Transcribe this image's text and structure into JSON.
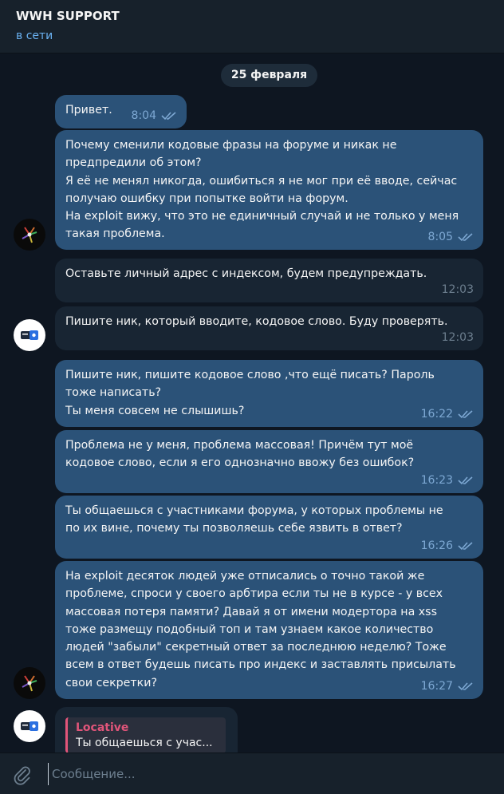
{
  "header": {
    "title": "WWH SUPPORT",
    "status": "в сети"
  },
  "date_separator": "25 февраля",
  "messages": [
    {
      "text": "Привет.",
      "time": "8:04"
    },
    {
      "text": "Почему сменили кодовые фразы на форуме и никак не\nпредпредили об этом?\nЯ её не менял никогда, ошибиться я не мог при её вводе, сейчас\nполучаю ошибку при попытке войти на форум.\nНа exploit вижу, что это не единичный случай и не только у меня\nтакая проблема.",
      "time": "8:05"
    },
    {
      "text": "Оставьте личный адрес с индексом, будем предупреждать.",
      "time": "12:03"
    },
    {
      "text": "Пишите ник, который вводите, кодовое слово. Буду проверять.",
      "time": "12:03"
    },
    {
      "text": "Пишите ник, пишите кодовое слово ,что ещё писать? Пароль\nтоже написать?\nТы меня совсем не слышишь?",
      "time": "16:22"
    },
    {
      "text": "Проблема не у меня, проблема массовая! Причём тут моё\nкодовое слово, если я его однозначно ввожу без ошибок?",
      "time": "16:23"
    },
    {
      "text": "Ты общаешься с участниками форума, у которых проблемы не\nпо их вине, почему ты позволяешь себе язвить в ответ?",
      "time": "16:26"
    },
    {
      "text": "На exploit десяток людей уже отписались о точно такой же\nпроблеме, спроси у своего арбтира если ты не в курсе - у всех\nмассовая потеря памяти? Давай я от имени модертора на xss\nтоже размещу подобный топ и там узнаем какое количество\nлюдей \"забыли\" секретный ответ за последнюю неделю? Тоже\nвсем в ответ будешь писать про индекс и заставлять присылать\nсвои секретки?",
      "time": "16:27"
    }
  ],
  "reply_preview": {
    "name": "Locative",
    "text": "Ты общаешься с учас..."
  },
  "composer": {
    "placeholder": "Сообщение..."
  },
  "colors": {
    "background": "#0e1621",
    "header": "#17212b",
    "outgoing_bubble": "#2b5278",
    "incoming_bubble": "#182533",
    "accent": "#6ab2f2",
    "reply_name": "#e1557a"
  }
}
